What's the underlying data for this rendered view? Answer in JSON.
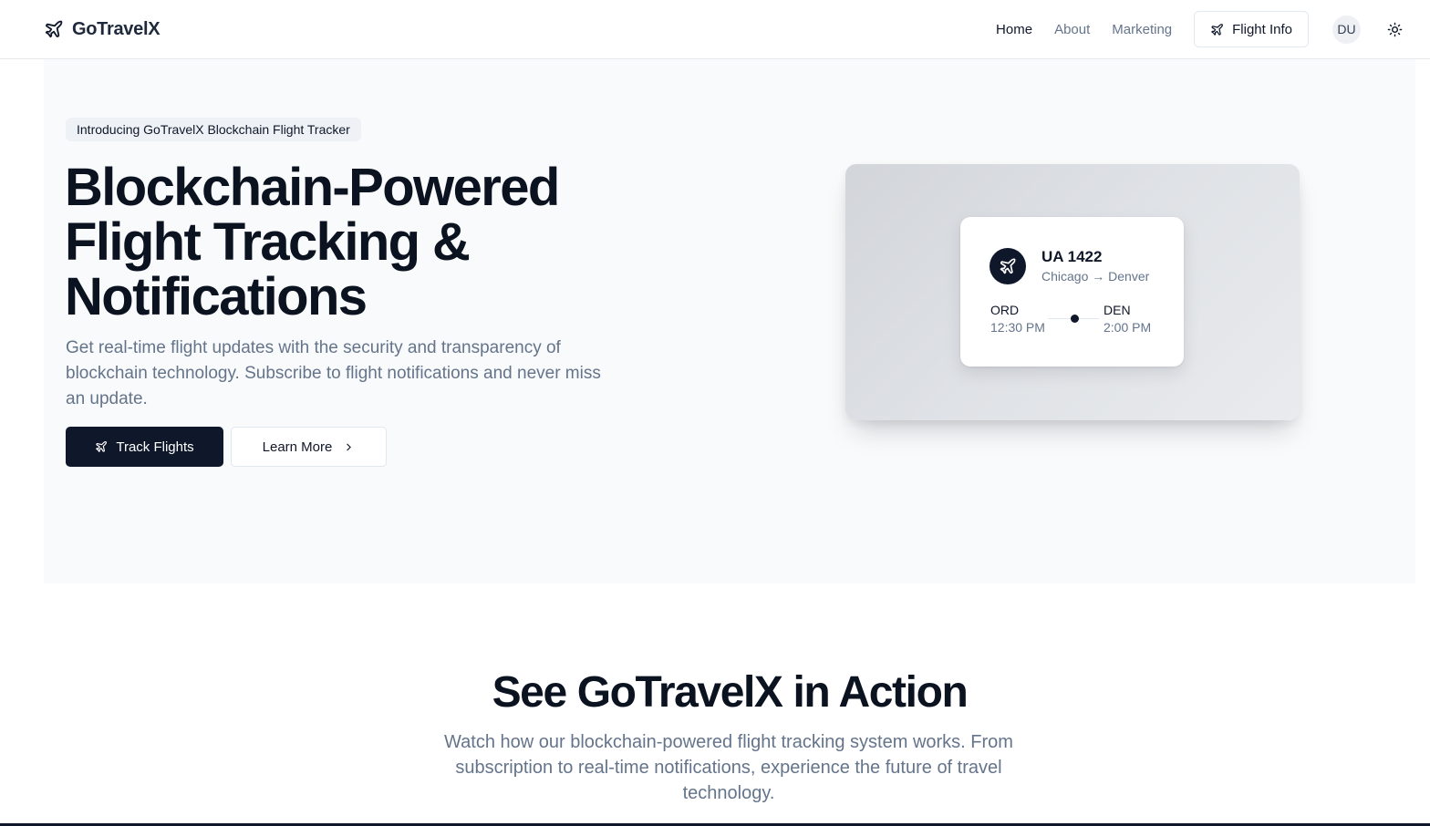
{
  "header": {
    "brand": "GoTravelX",
    "nav": [
      {
        "label": "Home",
        "active": true
      },
      {
        "label": "About",
        "active": false
      },
      {
        "label": "Marketing",
        "active": false
      }
    ],
    "flight_info_button": "Flight Info",
    "avatar_initials": "DU",
    "theme_icon": "sun-icon"
  },
  "hero": {
    "badge": "Introducing GoTravelX Blockchain Flight Tracker",
    "title_lines": [
      "Blockchain-Powered",
      "Flight Tracking &",
      "Notifications"
    ],
    "subtitle": "Get real-time flight updates with the security and transparency of blockchain technology. Subscribe to flight notifications and never miss an update.",
    "primary_button": "Track Flights",
    "secondary_button": "Learn More"
  },
  "flight_card": {
    "flight_number": "UA 1422",
    "route": "Chicago → Denver",
    "origin": {
      "code": "ORD",
      "time": "12:30 PM"
    },
    "destination": {
      "code": "DEN",
      "time": "2:00 PM"
    }
  },
  "section": {
    "title": "See GoTravelX in Action",
    "subtitle": "Watch how our blockchain-powered flight tracking system works. From subscription to real-time notifications, experience the future of travel technology."
  },
  "colors": {
    "primary": "#0f172a",
    "muted_text": "#64748b",
    "hero_background": "#f9fafb",
    "border": "#e2e8f0"
  }
}
